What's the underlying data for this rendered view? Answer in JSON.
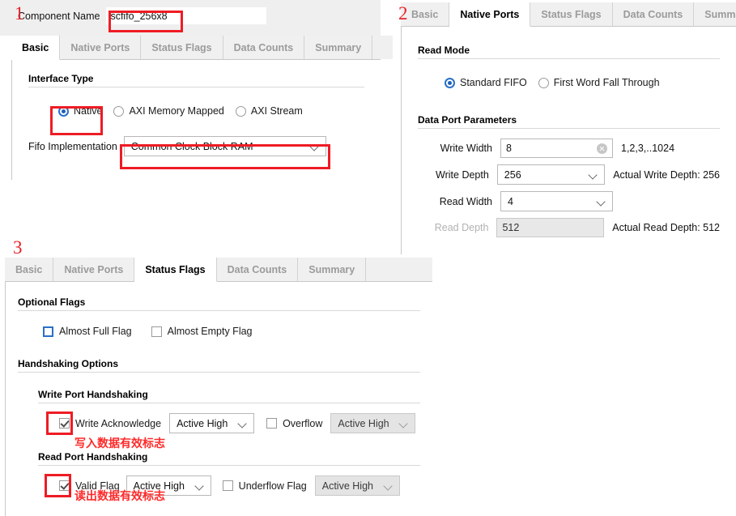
{
  "markers": [
    {
      "id": "1",
      "label": "1"
    },
    {
      "id": "2",
      "label": "2"
    },
    {
      "id": "3",
      "label": "3"
    }
  ],
  "colors": {
    "annotation_red": "#ee1c24",
    "note_red": "#ff2a2a",
    "accent_blue": "#1f5fb8",
    "tab_inactive_text": "#9b9b9b",
    "panel_bg": "#ffffff",
    "tabstrip_bg": "#f0f0f0"
  },
  "tabs": [
    "Basic",
    "Native Ports",
    "Status Flags",
    "Data Counts",
    "Summary"
  ],
  "panel1": {
    "component_name_label": "Component Name",
    "component_name_value": "scfifo_256x8",
    "active_tab": "Basic",
    "section_interface_type": "Interface Type",
    "interface_options": [
      {
        "label": "Native",
        "selected": true
      },
      {
        "label": "AXI Memory Mapped",
        "selected": false
      },
      {
        "label": "AXI Stream",
        "selected": false
      }
    ],
    "fifo_impl_label": "Fifo Implementation",
    "fifo_impl_value": "Common Clock Block RAM"
  },
  "panel2": {
    "active_tab": "Native Ports",
    "section_read_mode": "Read Mode",
    "read_mode_options": [
      {
        "label": "Standard FIFO",
        "selected": true
      },
      {
        "label": "First Word Fall Through",
        "selected": false
      }
    ],
    "section_data_port_parameters": "Data Port Parameters",
    "rows": [
      {
        "label": "Write Width",
        "value": "8",
        "kind": "text",
        "disabled": false,
        "has_clear": true,
        "hint": "1,2,3,..1024"
      },
      {
        "label": "Write Depth",
        "value": "256",
        "kind": "combo",
        "disabled": false,
        "has_clear": false,
        "hint": "Actual Write Depth: 256"
      },
      {
        "label": "Read Width",
        "value": "4",
        "kind": "combo",
        "disabled": false,
        "has_clear": false,
        "hint": ""
      },
      {
        "label": "Read Depth",
        "value": "512",
        "kind": "text",
        "disabled": true,
        "has_clear": false,
        "hint": "Actual Read Depth: 512"
      }
    ]
  },
  "panel3": {
    "active_tab": "Status Flags",
    "section_optional_flags": "Optional Flags",
    "optional_flags": [
      {
        "label": "Almost Full Flag",
        "checked": false,
        "focused": true
      },
      {
        "label": "Almost Empty Flag",
        "checked": false,
        "focused": false
      }
    ],
    "section_handshaking_options": "Handshaking Options",
    "write_port_title": "Write Port Handshaking",
    "write_port": {
      "primary_label": "Write Acknowledge",
      "primary_checked": true,
      "primary_polarity": "Active High",
      "primary_polarity_disabled": false,
      "secondary_label": "Overflow",
      "secondary_checked": false,
      "secondary_polarity": "Active High",
      "secondary_polarity_disabled": true
    },
    "read_port_title": "Read Port Handshaking",
    "read_port": {
      "primary_label": "Valid Flag",
      "primary_checked": true,
      "primary_polarity": "Active High",
      "primary_polarity_disabled": false,
      "secondary_label": "Underflow Flag",
      "secondary_checked": false,
      "secondary_polarity": "Active High",
      "secondary_polarity_disabled": true
    },
    "note_write": "写入数据有效标志",
    "note_read": "读出数据有效标志"
  }
}
